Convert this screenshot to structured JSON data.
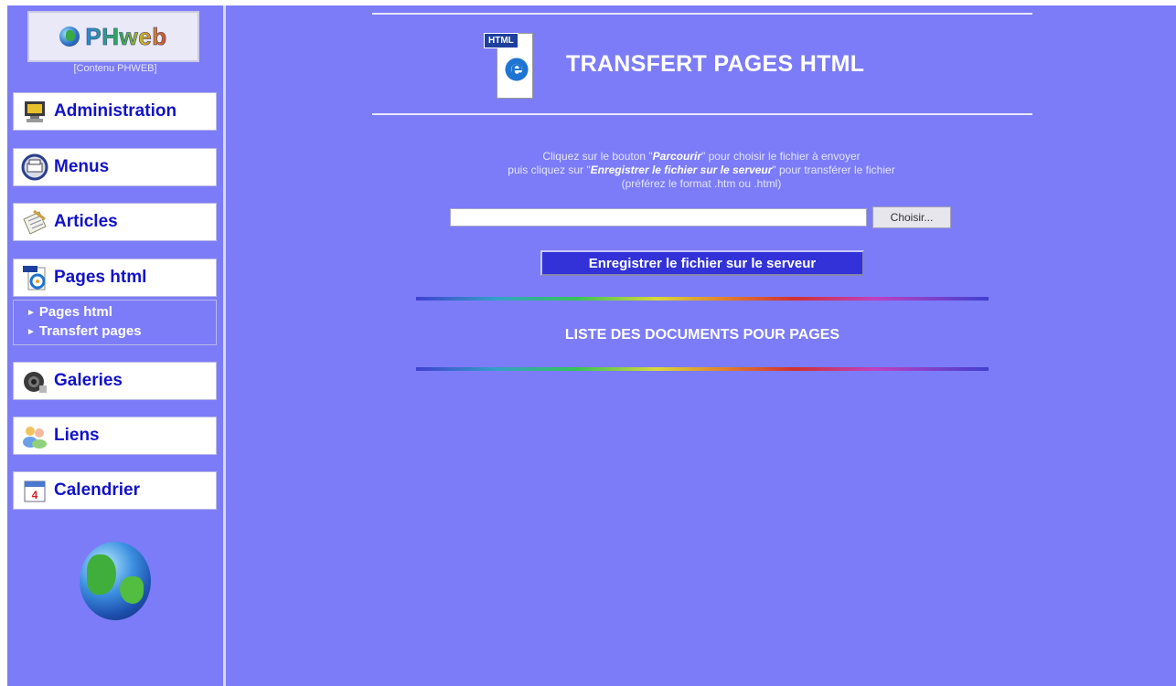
{
  "sidebar": {
    "logo_text": "PHweb",
    "caption": "[Contenu PHWEB]",
    "nav_items": [
      {
        "label": "Administration",
        "icon": "monitor-icon"
      },
      {
        "label": "Menus",
        "icon": "printer-icon"
      },
      {
        "label": "Articles",
        "icon": "notepad-icon"
      },
      {
        "label": "Pages html",
        "icon": "html-ie-icon"
      },
      {
        "label": "Galeries",
        "icon": "camera-icon"
      },
      {
        "label": "Liens",
        "icon": "users-icon"
      },
      {
        "label": "Calendrier",
        "icon": "calendar-icon"
      }
    ],
    "submenu": [
      "Pages html",
      "Transfert pages"
    ],
    "submenu_arrow": "►"
  },
  "main": {
    "icon_tag": "HTML",
    "title": "TRANSFERT PAGES HTML",
    "instructions": {
      "line1_before": "Cliquez sur le bouton \"",
      "line1_bold": "Parcourir",
      "line1_after": "\" pour choisir le fichier à envoyer",
      "line2_before": "puis cliquez sur \"",
      "line2_bold": "Enregistrer le fichier sur le serveur",
      "line2_after": "\" pour transférer le fichier",
      "line3": "(préférez le format .htm ou .html)"
    },
    "file_input_value": "",
    "choose_button": "Choisir...",
    "submit_button": "Enregistrer le fichier sur le serveur",
    "list_title": "LISTE DES DOCUMENTS POUR PAGES"
  },
  "colors": {
    "background": "#7c7cf8",
    "nav_text": "#1212c8",
    "submit_bg": "#3232d8"
  }
}
